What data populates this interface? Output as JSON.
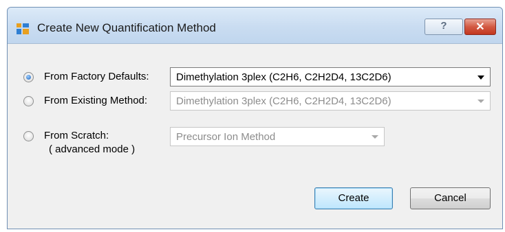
{
  "window": {
    "title": "Create New Quantification Method",
    "help_label": "?",
    "close_label": "✕"
  },
  "options": [
    {
      "label": "From Factory Defaults:",
      "selected": true,
      "combo_value": "Dimethylation 3plex (C2H6, C2H2D4, 13C2D6)",
      "combo_enabled": true
    },
    {
      "label": "From Existing Method:",
      "selected": false,
      "combo_value": "Dimethylation 3plex (C2H6, C2H2D4, 13C2D6)",
      "combo_enabled": false
    },
    {
      "label": "From Scratch:",
      "sublabel": "( advanced mode )",
      "selected": false,
      "combo_value": "Precursor Ion Method",
      "combo_enabled": false
    }
  ],
  "buttons": {
    "create": "Create",
    "cancel": "Cancel"
  },
  "colors": {
    "title_bar": "#c9dcf1",
    "close_button": "#c2361f",
    "dialog_background": "#f0f0f0",
    "radio_checked": "#1c5fb8"
  }
}
